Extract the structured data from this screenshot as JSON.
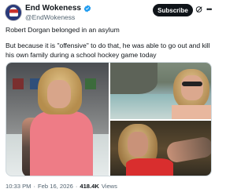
{
  "author": {
    "display_name": "End Wokeness",
    "handle": "@EndWokeness",
    "verified": true
  },
  "actions": {
    "subscribe_label": "Subscribe",
    "grok_icon": "grok-icon",
    "more_icon": "more-icon"
  },
  "post": {
    "line1": "Robert Dorgan belonged in an asylum",
    "line2": "But because it is \"offensive\" to do that, he was able to go out and kill his own family during a school hockey game today"
  },
  "media": {
    "images": [
      "photo-hockey-rink",
      "photo-river",
      "photo-selfie"
    ]
  },
  "meta": {
    "time": "10:33 PM",
    "separator1": "·",
    "date": "Feb 16, 2026",
    "separator2": "·",
    "views_count": "418.4K",
    "views_label": "Views"
  },
  "colors": {
    "verified": "#1d9bf0",
    "text": "#0f1419",
    "secondary": "#536471",
    "button_bg": "#0f1419"
  }
}
